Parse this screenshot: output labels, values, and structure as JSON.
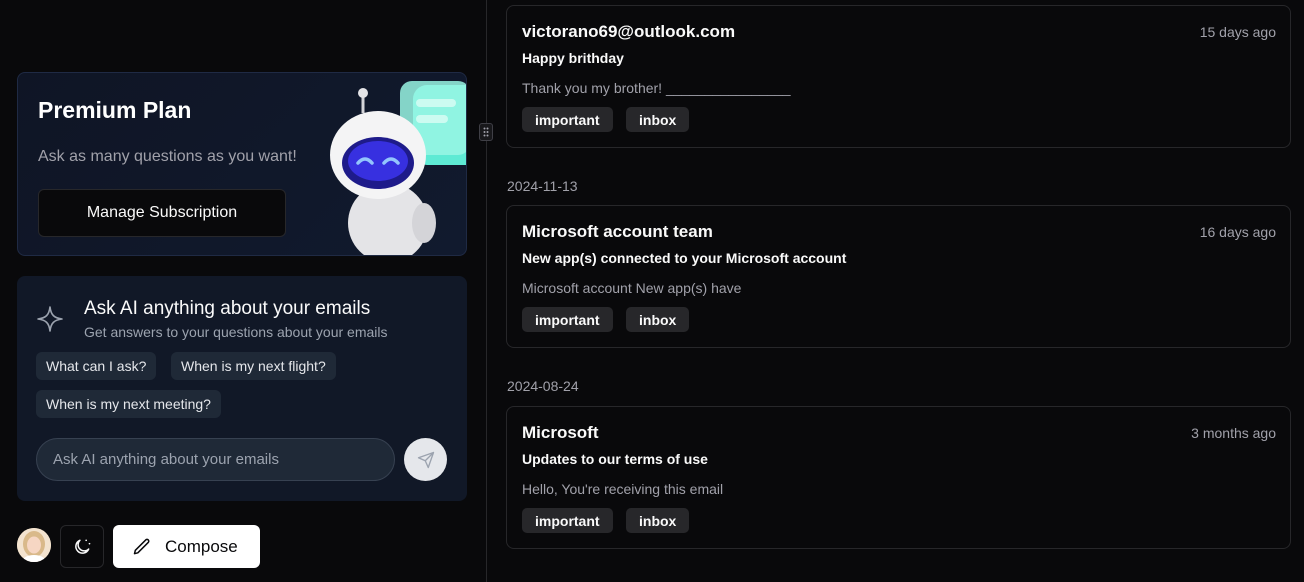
{
  "premium": {
    "title": "Premium Plan",
    "description": "Ask as many questions as you want!",
    "button_label": "Manage Subscription"
  },
  "ask_ai": {
    "icon": "sparkle-icon",
    "title": "Ask AI anything about your emails",
    "subtitle": "Get answers to your questions about your emails",
    "suggestions": [
      "What can I ask?",
      "When is my next flight?",
      "When is my next meeting?"
    ],
    "input_placeholder": "Ask AI anything about your emails",
    "send_icon": "send-icon"
  },
  "footer": {
    "theme_icon": "moon-icon",
    "compose_label": "Compose",
    "compose_icon": "pencil-icon"
  },
  "mail_groups": [
    {
      "date": "",
      "emails": [
        {
          "sender": "victorano69@outlook.com",
          "time": "15 days ago",
          "subject": "Happy brithday",
          "preview": "Thank you my brother! ________________",
          "tags": [
            "important",
            "inbox"
          ]
        }
      ]
    },
    {
      "date": "2024-11-13",
      "emails": [
        {
          "sender": "Microsoft account team",
          "time": "16 days ago",
          "subject": "New app(s) connected to your Microsoft account",
          "preview": "Microsoft account New app(s) have",
          "tags": [
            "important",
            "inbox"
          ]
        }
      ]
    },
    {
      "date": "2024-08-24",
      "emails": [
        {
          "sender": "Microsoft",
          "time": "3 months ago",
          "subject": "Updates to our terms of use",
          "preview": "Hello, You're receiving this email",
          "tags": [
            "important",
            "inbox"
          ]
        }
      ]
    }
  ]
}
